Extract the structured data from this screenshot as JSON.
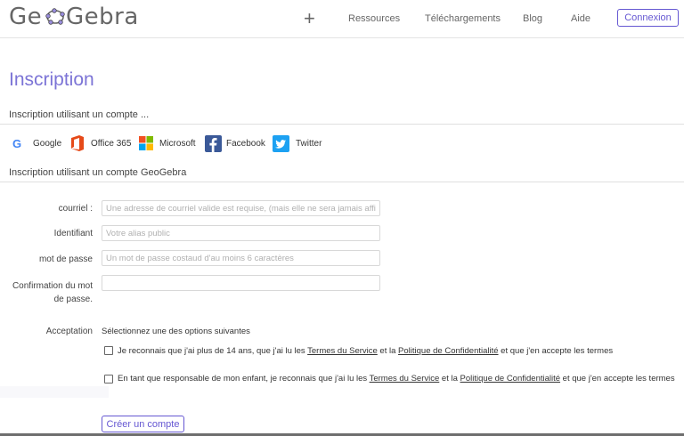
{
  "header": {
    "logo_text": "GeoGebra",
    "plus": "+",
    "nav": [
      "Ressources",
      "Téléchargements",
      "Blog",
      "Aide"
    ],
    "login": "Connexion"
  },
  "title": "Inscription",
  "social_section": "Inscription utilisant un compte ...",
  "social": [
    "Google",
    "Office 365",
    "Microsoft",
    "Facebook",
    "Twitter"
  ],
  "account_section": "Inscription utilisant un compte GeoGebra",
  "form": {
    "email_label": "courriel :",
    "email_placeholder": "Une adresse de courriel valide est requise, (mais elle ne sera jamais affichée)",
    "id_label": "Identifiant",
    "id_placeholder": "Votre alias public",
    "password_label": "mot de passe",
    "password_placeholder": "Un mot de passe costaud d'au moins 6 caractères",
    "confirm_label_1": "Confirmation du mot",
    "confirm_label_2": "de passe.",
    "acceptance_label": "Acceptation",
    "acceptance_intro": "Sélectionnez une des options suivantes",
    "option1": {
      "pre": "Je reconnais que j'ai plus de 14 ans, que j'ai lu les ",
      "terms": "Termes du Service",
      "mid": " et la ",
      "privacy": "Politique de Confidentialité",
      "post": " et que j'en accepte les termes"
    },
    "option2": {
      "pre": "En tant que responsable de mon enfant, je reconnais que j'ai lu les ",
      "terms": "Termes du Service",
      "mid": " et la ",
      "privacy": "Politique de Confidentialité",
      "post": " et que j'en accepte les termes"
    },
    "submit": "Créer un compte"
  },
  "colors": {
    "accent": "#6557d2",
    "title": "#7c74d6"
  }
}
